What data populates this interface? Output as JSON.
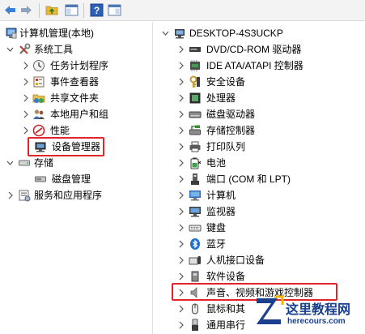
{
  "left_tree": [
    {
      "label": "计算机管理(本地)",
      "icon": "computer-management-icon",
      "expander": "none"
    },
    {
      "label": "系统工具",
      "icon": "toolbox-icon",
      "expander": "expanded"
    },
    {
      "label": "任务计划程序",
      "icon": "clock-icon",
      "expander": "collapsed"
    },
    {
      "label": "事件查看器",
      "icon": "event-viewer-icon",
      "expander": "collapsed"
    },
    {
      "label": "共享文件夹",
      "icon": "shared-folder-icon",
      "expander": "collapsed"
    },
    {
      "label": "本地用户和组",
      "icon": "users-icon",
      "expander": "collapsed"
    },
    {
      "label": "性能",
      "icon": "performance-icon",
      "expander": "collapsed"
    },
    {
      "label": "设备管理器",
      "icon": "device-manager-icon",
      "expander": "none"
    },
    {
      "label": "存储",
      "icon": "storage-icon",
      "expander": "expanded"
    },
    {
      "label": "磁盘管理",
      "icon": "disk-management-icon",
      "expander": "none"
    },
    {
      "label": "服务和应用程序",
      "icon": "services-icon",
      "expander": "collapsed"
    }
  ],
  "right_tree": [
    {
      "label": "DESKTOP-4S3UCKP",
      "icon": "desktop-computer-icon",
      "expander": "expanded"
    },
    {
      "label": "DVD/CD-ROM 驱动器",
      "icon": "dvd-drive-icon",
      "expander": "collapsed"
    },
    {
      "label": "IDE ATA/ATAPI 控制器",
      "icon": "ide-controller-icon",
      "expander": "collapsed"
    },
    {
      "label": "安全设备",
      "icon": "security-device-icon",
      "expander": "collapsed"
    },
    {
      "label": "处理器",
      "icon": "processor-icon",
      "expander": "collapsed"
    },
    {
      "label": "磁盘驱动器",
      "icon": "disk-drive-icon",
      "expander": "collapsed"
    },
    {
      "label": "存储控制器",
      "icon": "storage-controller-icon",
      "expander": "collapsed"
    },
    {
      "label": "打印队列",
      "icon": "printer-icon",
      "expander": "collapsed"
    },
    {
      "label": "电池",
      "icon": "battery-icon",
      "expander": "collapsed"
    },
    {
      "label": "端口 (COM 和 LPT)",
      "icon": "port-icon",
      "expander": "collapsed"
    },
    {
      "label": "计算机",
      "icon": "computer-icon",
      "expander": "collapsed"
    },
    {
      "label": "监视器",
      "icon": "monitor-icon",
      "expander": "collapsed"
    },
    {
      "label": "键盘",
      "icon": "keyboard-icon",
      "expander": "collapsed"
    },
    {
      "label": "蓝牙",
      "icon": "bluetooth-icon",
      "expander": "collapsed"
    },
    {
      "label": "人机接口设备",
      "icon": "hid-icon",
      "expander": "collapsed"
    },
    {
      "label": "软件设备",
      "icon": "software-device-icon",
      "expander": "collapsed"
    },
    {
      "label": "声音、视频和游戏控制器",
      "icon": "speaker-icon",
      "expander": "collapsed"
    },
    {
      "label": "鼠标和其",
      "icon": "mouse-icon",
      "expander": "collapsed"
    },
    {
      "label": "通用串行",
      "icon": "usb-icon",
      "expander": "collapsed"
    }
  ],
  "highlight_color": "#e0262a",
  "watermark": {
    "title": "这里教程网",
    "url": "herecours.com"
  }
}
